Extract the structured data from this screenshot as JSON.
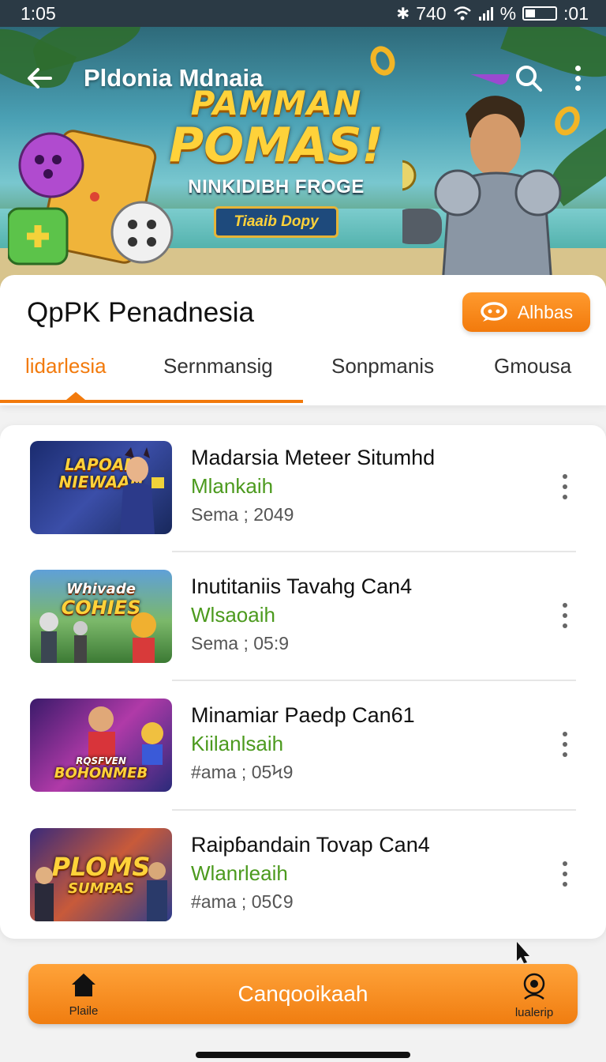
{
  "status_bar": {
    "time": "1:05",
    "right_text_1": "740",
    "right_text_2": "%",
    "right_text_3": ":01",
    "icons": [
      "bluetooth-icon",
      "wifi-icon",
      "signal-icon",
      "battery-icon"
    ]
  },
  "header": {
    "title": "Pldonia Mdnaia",
    "icons": [
      "back-arrow-icon",
      "search-icon",
      "more-vert-icon"
    ]
  },
  "promo": {
    "line1": "PAMMAN",
    "line2": "POMAS!",
    "line3": "NINKIDIBH FROGE",
    "badge": "Tiaaib Dopy"
  },
  "section": {
    "title": "QpPK Penadnesia",
    "action_label": "Alhbas",
    "action_icon": "chat-bubble-icon"
  },
  "tabs": [
    {
      "label": "lidarlesia",
      "active": true
    },
    {
      "label": "Sernmansig",
      "active": false
    },
    {
      "label": "Sonpmanis",
      "active": false
    },
    {
      "label": "Gmousa",
      "active": false
    }
  ],
  "items": [
    {
      "title": "Madarsia Meteer Situmhd",
      "subtitle": "Mlankaih",
      "meta": "Sema ; 2049",
      "thumb_line1": "LAPOAN",
      "thumb_line2": "NIEWAAN"
    },
    {
      "title": "Inutitaniis Tavahg Can4",
      "subtitle": "Wlsaoaih",
      "meta": "Sema ; 05:9",
      "thumb_line1": "Whivade",
      "thumb_line2": "COHIES"
    },
    {
      "title": "Minamiar Paedp Can61",
      "subtitle": "Kiilanlsaih",
      "meta": "#ama ; 05Ϟ9",
      "thumb_line1": "RQSFVEN",
      "thumb_line2": "BOHONMEB"
    },
    {
      "title": "Raipɓandain Tovap Can4",
      "subtitle": "Wlanrleaih",
      "meta": "#ama ; 05∁9",
      "thumb_line1": "PLOMS",
      "thumb_line2": "SUMPAS"
    }
  ],
  "bottom_bar": {
    "home_label": "Plaile",
    "primary_label": "Canqooikaah",
    "profile_label": "lualerip",
    "icons": [
      "home-icon",
      "profile-icon"
    ]
  },
  "colors": {
    "accent": "#f27a0c",
    "subtitle_green": "#4c9a1e",
    "status_bar": "#2b3a45"
  }
}
